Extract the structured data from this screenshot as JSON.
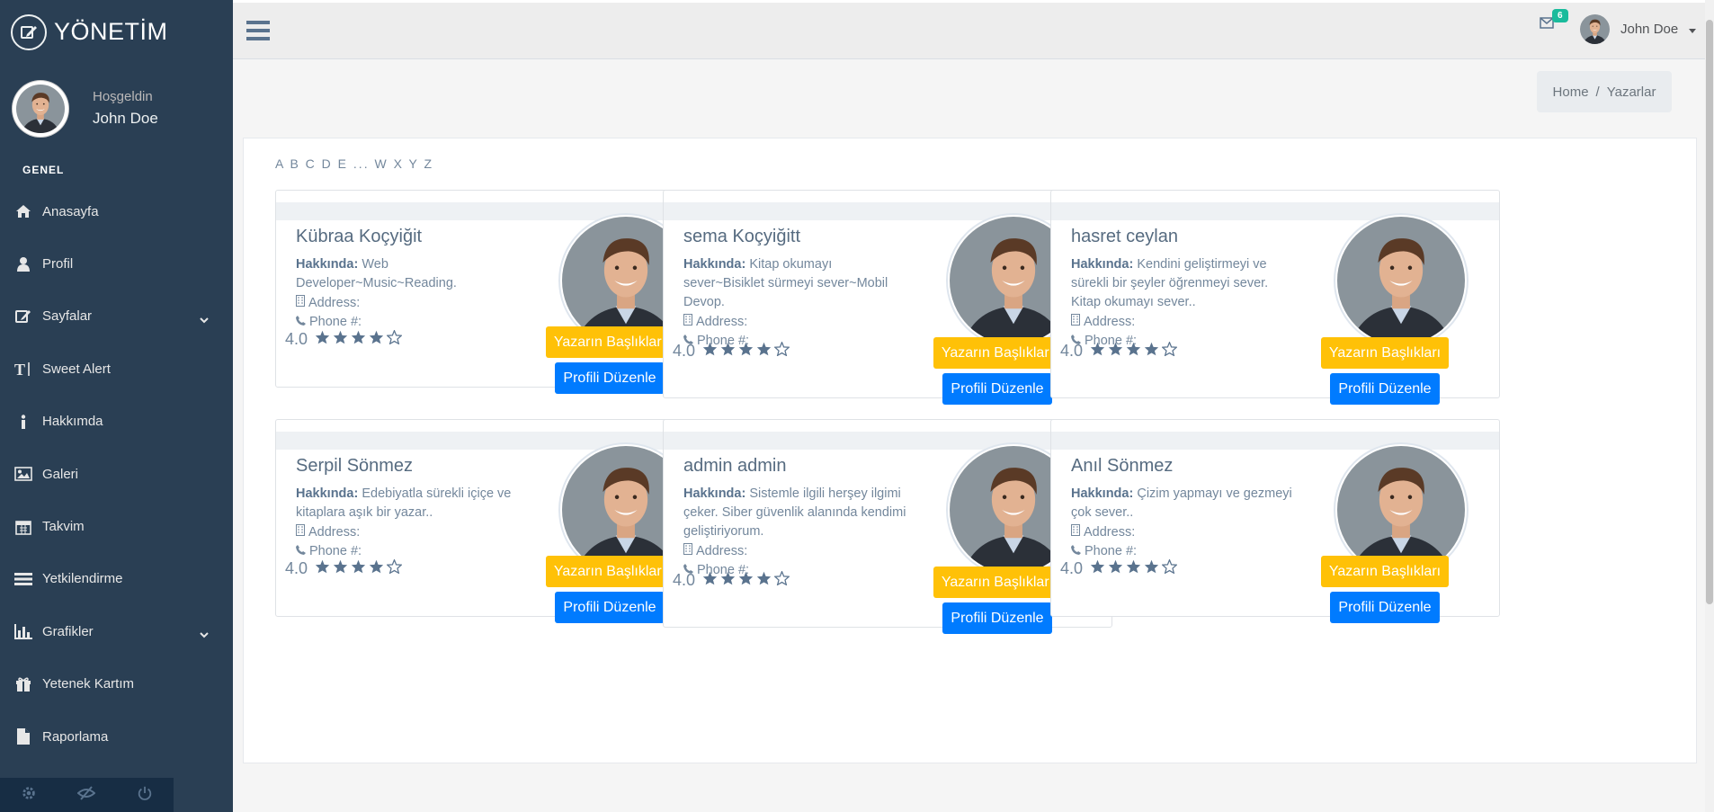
{
  "brand": {
    "title": "YÖNETİM"
  },
  "profile": {
    "welcome": "Hoşgeldin",
    "name": "John Doe"
  },
  "sidebar": {
    "section": "GENEL",
    "items": [
      {
        "label": "Anasayfa",
        "icon": "home-icon"
      },
      {
        "label": "Profil",
        "icon": "user-icon"
      },
      {
        "label": "Sayfalar",
        "icon": "edit-icon",
        "has_children": true
      },
      {
        "label": "Sweet Alert",
        "icon": "text-height-icon"
      },
      {
        "label": "Hakkımda",
        "icon": "info-icon"
      },
      {
        "label": "Galeri",
        "icon": "image-icon"
      },
      {
        "label": "Takvim",
        "icon": "calendar-icon"
      },
      {
        "label": "Yetkilendirme",
        "icon": "list-icon"
      },
      {
        "label": "Grafikler",
        "icon": "bar-chart-icon",
        "has_children": true
      },
      {
        "label": "Yetenek Kartım",
        "icon": "gift-icon"
      },
      {
        "label": "Raporlama",
        "icon": "file-icon"
      }
    ]
  },
  "topnav": {
    "mail_count": "6",
    "user": "John Doe"
  },
  "breadcrumb": {
    "home": "Home",
    "sep": "/",
    "current": "Yazarlar"
  },
  "alphabet": "A B C D E ... W X Y Z",
  "labels": {
    "about": "Hakkında:",
    "address": "Address:",
    "phone": "Phone #:",
    "titles_button": "Yazarın Başlıkları",
    "edit_button": "Profili Düzenle"
  },
  "authors": [
    {
      "name": "Kübraa Koçyiğit",
      "about": "Web Developer~Music~Reading.",
      "rating": "4.0",
      "stars": 4
    },
    {
      "name": "sema Koçyiğitt",
      "about": "Kitap okumayı sever~Bisiklet sürmeyi sever~Mobil Devop.",
      "rating": "4.0",
      "stars": 4
    },
    {
      "name": "hasret ceylan",
      "about": "Kendini geliştirmeyi ve sürekli bir şeyler öğrenmeyi sever. Kitap okumayı sever..",
      "rating": "4.0",
      "stars": 4
    },
    {
      "name": "Serpil Sönmez",
      "about": "Edebiyatla sürekli içiçe ve kitaplara aşık bir yazar..",
      "rating": "4.0",
      "stars": 4
    },
    {
      "name": "admin admin",
      "about": "Sistemle ilgili herşey ilgimi çeker. Siber güvenlik alanında kendimi geliştiriyorum.",
      "rating": "4.0",
      "stars": 4
    },
    {
      "name": "Anıl Sönmez",
      "about": "Çizim yapmayı ve gezmeyi çok sever..",
      "rating": "4.0",
      "stars": 4
    }
  ]
}
